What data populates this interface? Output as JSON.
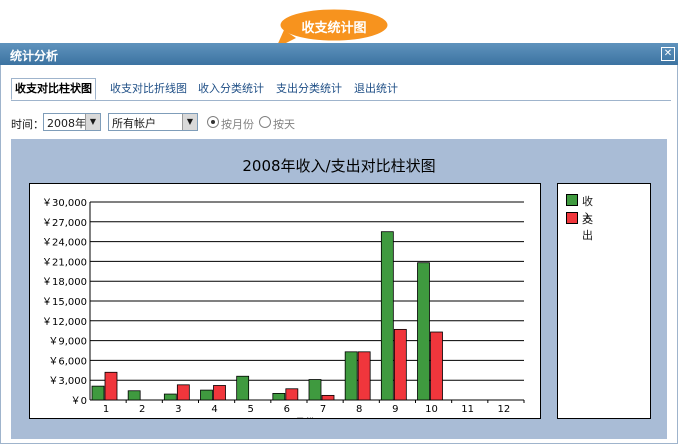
{
  "callout": {
    "text": "收支统计图"
  },
  "window": {
    "title": "统计分析",
    "close_icon": "close-icon"
  },
  "tabs": [
    {
      "label": "收支对比柱状图",
      "active": true
    },
    {
      "label": "收支对比折线图",
      "active": false
    },
    {
      "label": "收入分类统计",
      "active": false
    },
    {
      "label": "支出分类统计",
      "active": false
    },
    {
      "label": "退出统计",
      "active": false
    }
  ],
  "filters": {
    "time_label": "时间：",
    "year_value": "2008年",
    "account_value": "所有帐户",
    "by_month_label": "按月份",
    "by_day_label": "按天",
    "selected": "by_month"
  },
  "colors": {
    "income": "#3f9a3f",
    "expense": "#f0363c",
    "panel": "#a9bcd6",
    "titlebar": "#4a80ad"
  },
  "chart_data": {
    "type": "bar",
    "title": "2008年收入/支出对比柱状图",
    "xlabel": "月份",
    "ylabel": "",
    "categories": [
      "1",
      "2",
      "3",
      "4",
      "5",
      "6",
      "7",
      "8",
      "9",
      "10",
      "11",
      "12"
    ],
    "ylim": [
      0,
      30000
    ],
    "ytick_labels": [
      "￥0",
      "￥3,000",
      "￥6,000",
      "￥9,000",
      "￥12,000",
      "￥15,000",
      "￥18,000",
      "￥21,000",
      "￥24,000",
      "￥27,000",
      "￥30,000"
    ],
    "series": [
      {
        "name": "收入",
        "color": "#3f9a3f",
        "values": [
          2100,
          1400,
          900,
          1500,
          3600,
          1000,
          3100,
          7300,
          25500,
          20800,
          0,
          0
        ]
      },
      {
        "name": "支出",
        "color": "#f0363c",
        "values": [
          4200,
          0,
          2300,
          2200,
          0,
          1700,
          700,
          7300,
          10700,
          10300,
          0,
          0
        ]
      }
    ],
    "legend_position": "right",
    "grid": true
  }
}
